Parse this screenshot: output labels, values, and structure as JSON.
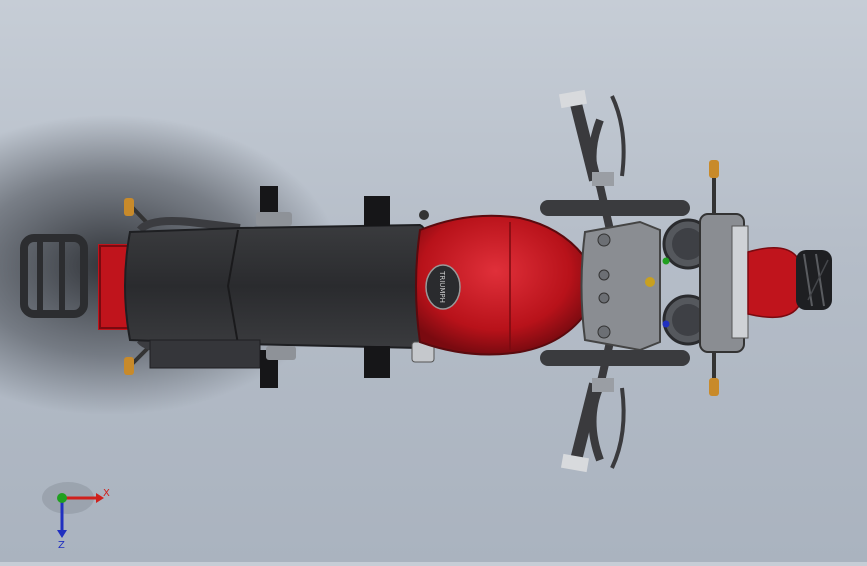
{
  "viewport": {
    "model": "motorcycle-top-view",
    "background": {
      "top": "#c6cdd6",
      "bottom": "#aab3bf"
    },
    "colors": {
      "tank_red": "#c0141c",
      "seat_dark": "#2f3032",
      "frame_gray": "#5a5c60",
      "chrome": "#9a9ea4",
      "amber": "#c88a2a"
    },
    "tank_badge_text": "TRIUMPH"
  },
  "triad": {
    "x_label": "X",
    "z_label": "Z",
    "x_color": "#d0201c",
    "y_color": "#20a020",
    "z_color": "#2030c0"
  }
}
